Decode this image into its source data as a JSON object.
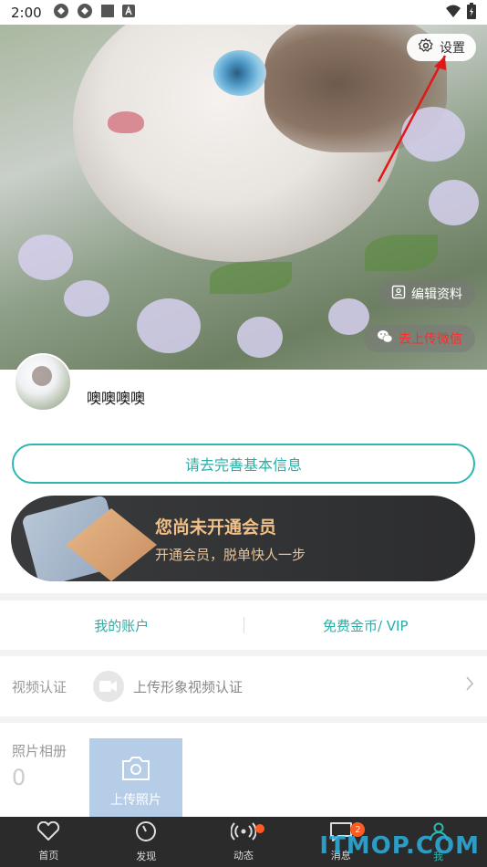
{
  "status_bar": {
    "time": "2:00"
  },
  "hero": {
    "settings_label": "设置",
    "edit_profile_label": "编辑资料",
    "upload_wechat_label": "去上传微信"
  },
  "profile": {
    "nickname": "噢噢噢噢",
    "complete_info_label": "请去完善基本信息"
  },
  "vip_banner": {
    "title": "您尚未开通会员",
    "subtitle": "开通会员，脱单快人一步"
  },
  "account": {
    "my_account": "我的账户",
    "free_coins_vip": "免费金币/ VIP"
  },
  "video_verify": {
    "label": "视频认证",
    "action": "上传形象视频认证",
    "icon": "video-camera-icon"
  },
  "album": {
    "label": "照片相册",
    "count": "0",
    "upload_label": "上传照片"
  },
  "tabbar": {
    "items": [
      {
        "label": "首页",
        "icon": "heart-icon"
      },
      {
        "label": "发现",
        "icon": "compass-icon"
      },
      {
        "label": "动态",
        "icon": "broadcast-icon"
      },
      {
        "label": "消息",
        "icon": "chat-icon",
        "badge": "2"
      },
      {
        "label": "我",
        "icon": "user-icon"
      }
    ]
  },
  "watermark": "ITMOP.COM",
  "colors": {
    "accent": "#2db7b0",
    "badge": "#ff5a1f",
    "tabbar_bg": "#2b2b2b",
    "vip_gold": "#f0c088"
  }
}
